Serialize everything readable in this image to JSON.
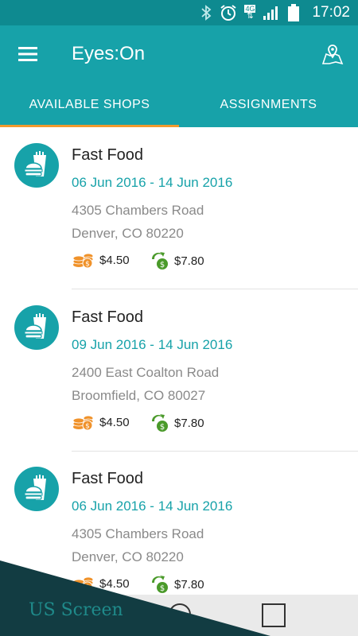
{
  "status_bar": {
    "time": "17:02",
    "network": "4G"
  },
  "app_bar": {
    "title": "Eyes:On"
  },
  "tabs": [
    {
      "label": "AVAILABLE SHOPS",
      "active": true
    },
    {
      "label": "ASSIGNMENTS",
      "active": false
    }
  ],
  "shops": [
    {
      "title": "Fast Food",
      "dates": "06 Jun 2016 - 14 Jun 2016",
      "address_line1": "4305 Chambers Road",
      "address_line2": "Denver, CO 80220",
      "fee": "$4.50",
      "reimbursement": "$7.80"
    },
    {
      "title": "Fast Food",
      "dates": "09 Jun 2016 - 14 Jun 2016",
      "address_line1": "2400 East Coalton Road",
      "address_line2": "Broomfield, CO 80027",
      "fee": "$4.50",
      "reimbursement": "$7.80"
    },
    {
      "title": "Fast Food",
      "dates": "06 Jun 2016 - 14 Jun 2016",
      "address_line1": "4305 Chambers Road",
      "address_line2": "Denver, CO 80220",
      "fee": "$4.50",
      "reimbursement": "$7.80"
    }
  ],
  "watermark": "US Screen",
  "colors": {
    "primary": "#17a2a9",
    "primary_dark": "#0e8a90",
    "accent": "#f29a2e",
    "coin": "#f0922a",
    "reimb": "#4a9a2a"
  },
  "icons": {
    "menu": "hamburger-icon",
    "map": "map-marker-icon",
    "shop": "fast-food-icon",
    "fee": "coins-icon",
    "reimb": "reimbursement-icon"
  }
}
